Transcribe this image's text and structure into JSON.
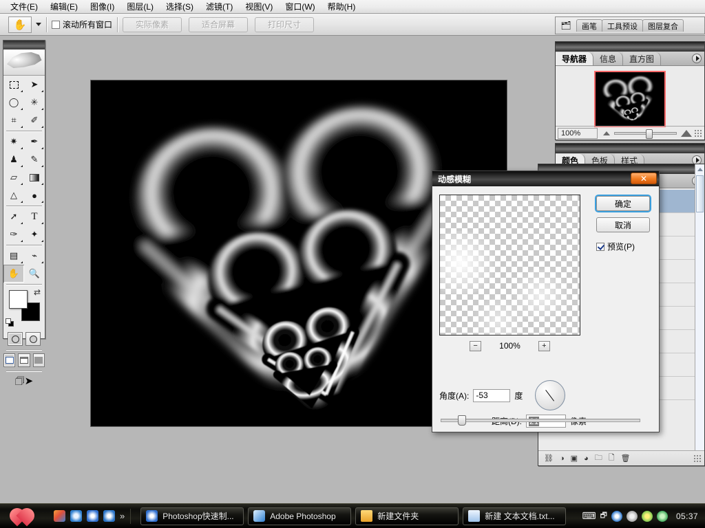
{
  "menubar": {
    "items": [
      {
        "label": "文件(E)"
      },
      {
        "label": "编辑(E)"
      },
      {
        "label": "图像(I)"
      },
      {
        "label": "图层(L)"
      },
      {
        "label": "选择(S)"
      },
      {
        "label": "滤镜(T)"
      },
      {
        "label": "视图(V)"
      },
      {
        "label": "窗口(W)"
      },
      {
        "label": "帮助(H)"
      }
    ]
  },
  "optionsbar": {
    "tool_icon": "hand-icon",
    "scroll_all_windows": "滚动所有窗口",
    "scroll_all_windows_checked": false,
    "buttons": [
      {
        "label": "实际像素",
        "enabled": false
      },
      {
        "label": "适合屏幕",
        "enabled": false
      },
      {
        "label": "打印尺寸",
        "enabled": false
      }
    ]
  },
  "toolbox": {
    "tools": [
      {
        "name": "marquee-tool",
        "glyph": "▭"
      },
      {
        "name": "move-tool",
        "glyph": "➤"
      },
      {
        "name": "lasso-tool",
        "glyph": "◯"
      },
      {
        "name": "magic-wand-tool",
        "glyph": "✳"
      },
      {
        "name": "crop-tool",
        "glyph": "⌗"
      },
      {
        "name": "slice-tool",
        "glyph": "✎"
      },
      {
        "name": "healing-brush-tool",
        "glyph": "✷"
      },
      {
        "name": "brush-tool",
        "glyph": "✒"
      },
      {
        "name": "clone-stamp-tool",
        "glyph": "♜"
      },
      {
        "name": "history-brush-tool",
        "glyph": "✎"
      },
      {
        "name": "eraser-tool",
        "glyph": "▱"
      },
      {
        "name": "gradient-tool",
        "glyph": "▮"
      },
      {
        "name": "blur-tool",
        "glyph": "△"
      },
      {
        "name": "dodge-tool",
        "glyph": "●"
      },
      {
        "name": "path-selection-tool",
        "glyph": "➚"
      },
      {
        "name": "type-tool",
        "glyph": "T"
      },
      {
        "name": "pen-tool",
        "glyph": "✑"
      },
      {
        "name": "custom-shape-tool",
        "glyph": "✦"
      },
      {
        "name": "notes-tool",
        "glyph": "🗒"
      },
      {
        "name": "eyedropper-tool",
        "glyph": "⌁"
      },
      {
        "name": "hand-tool",
        "glyph": "✋",
        "selected": true
      },
      {
        "name": "zoom-tool",
        "glyph": "🔍"
      }
    ],
    "foreground_color": "#ffffff",
    "background_color": "#000000",
    "mask_modes": [
      "standard-mask-mode",
      "quick-mask-mode"
    ],
    "screen_modes": [
      "standard-screen-mode",
      "full-screen-menubar-mode",
      "full-screen-mode"
    ],
    "jump_to_imageready": "jump-to-imageready-icon"
  },
  "palette_well": {
    "tabs": [
      "画笔",
      "工具预设",
      "图层复合"
    ]
  },
  "navigator_panel": {
    "tabs": [
      {
        "label": "导航器",
        "active": true
      },
      {
        "label": "信息",
        "active": false
      },
      {
        "label": "直方图",
        "active": false
      }
    ],
    "zoom_value": "100%",
    "thumbnail_border_color": "#ff6a6a"
  },
  "color_panel": {
    "tabs": [
      {
        "label": "颜色",
        "active": true
      },
      {
        "label": "色板",
        "active": false
      },
      {
        "label": "样式",
        "active": false
      }
    ],
    "sliders": [
      {
        "label": "%",
        "value": ""
      },
      {
        "label": "%",
        "value": ""
      }
    ]
  },
  "layers_panel": {
    "footer_icons": [
      "link-layers-icon",
      "layer-style-icon",
      "layer-mask-icon",
      "adjustment-layer-icon",
      "new-group-icon",
      "new-layer-icon",
      "delete-layer-icon",
      "resize-grip-icon"
    ]
  },
  "dialog": {
    "title": "动感模糊",
    "close_label": "✕",
    "ok_label": "确定",
    "cancel_label": "取消",
    "preview_label": "预览(P)",
    "preview_checked": true,
    "zoom_out_label": "−",
    "zoom_in_label": "+",
    "zoom_value": "100%",
    "angle_label": "角度(A):",
    "angle_value": "-53",
    "angle_unit": "度",
    "distance_label": "距离(D):",
    "distance_value": "21",
    "distance_unit": "像素",
    "accent_color": "#3aa0e0",
    "close_button_color": "#f07a1e"
  },
  "document": {
    "background_color": "#000000",
    "artwork": "three-nested-glowing-hearts"
  },
  "taskbar": {
    "start_icon": "heart-start-icon",
    "quick_launch": [
      {
        "name": "show-desktop-icon",
        "color": "#e07020"
      },
      {
        "name": "browser-icon",
        "color": "#3a8ad8"
      },
      {
        "name": "maxthon-icon",
        "color": "#2f6fd0"
      },
      {
        "name": "kingsoft-icon",
        "color": "#2a74c8"
      },
      {
        "name": "more-chevron-icon",
        "color": "#cccccc"
      }
    ],
    "windows": [
      {
        "label": "Photoshop快速制...",
        "icon": "maxthon-icon",
        "active": false
      },
      {
        "label": "Adobe Photoshop",
        "icon": "photoshop-icon",
        "active": false
      },
      {
        "label": "新建文件夹",
        "icon": "folder-icon",
        "active": false
      },
      {
        "label": "新建 文本文档.txt...",
        "icon": "notepad-icon",
        "active": false
      }
    ],
    "tray_icons": [
      {
        "name": "keyboard-layout-icon"
      },
      {
        "name": "tray-expand-icon"
      },
      {
        "name": "kingsoft-tray-icon",
        "color": "#2a74c8"
      },
      {
        "name": "volume-tray-icon",
        "color": "#b9b9b9"
      },
      {
        "name": "antivirus-tray-icon",
        "color": "#6cc04a"
      },
      {
        "name": "shield-tray-icon",
        "color": "#2f9e4f"
      }
    ],
    "clock": "05:37"
  }
}
